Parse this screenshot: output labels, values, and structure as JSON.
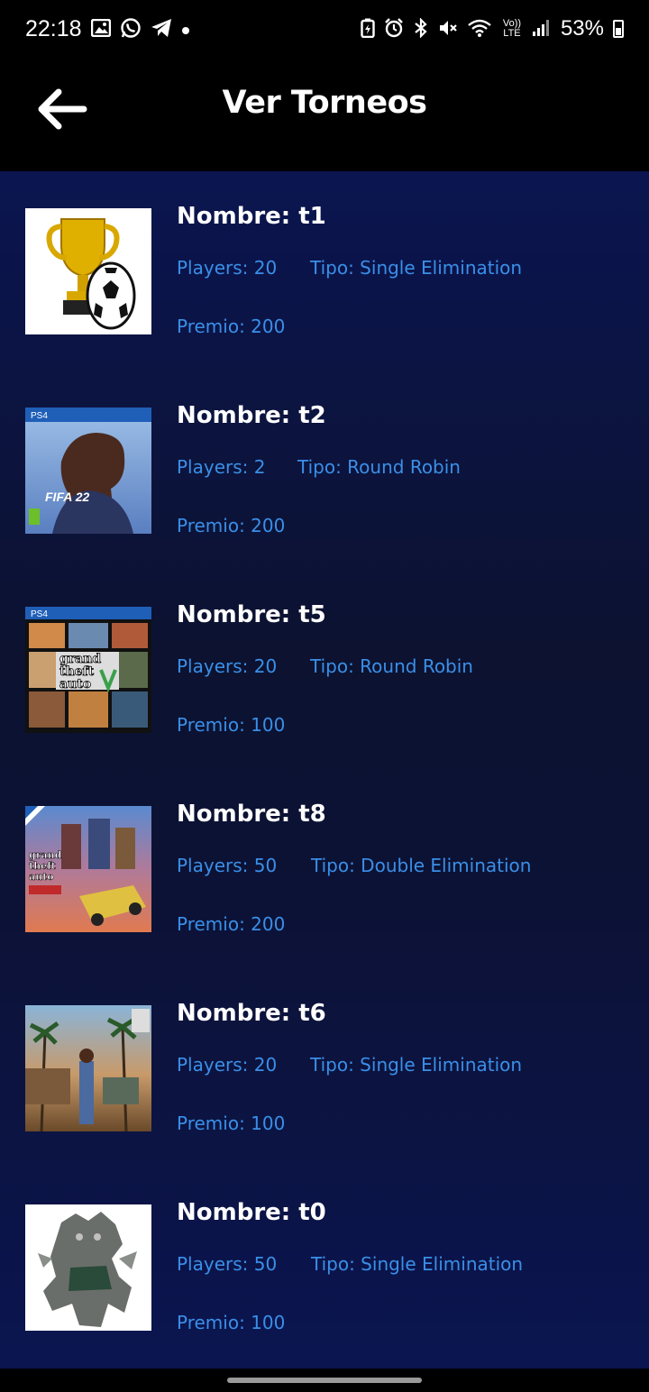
{
  "status_bar": {
    "time": "22:18",
    "left_icons": [
      "image-icon",
      "whatsapp-icon",
      "telegram-icon",
      "dot-icon"
    ],
    "right_icons": [
      "battery-saver-icon",
      "alarm-icon",
      "bluetooth-icon",
      "mute-icon",
      "wifi-icon",
      "volte-icon",
      "signal-icon"
    ],
    "volte_label": "Vo)) LTE",
    "battery_percent": "53%"
  },
  "header": {
    "title": "Ver Torneos",
    "back_icon": "arrow-left-icon"
  },
  "colors": {
    "accent": "#3a8fe8",
    "list_background": "#0c1235",
    "header_background": "#000000"
  },
  "tournaments": [
    {
      "name": "Nombre: t1",
      "players": "Players: 20",
      "tipo": "Tipo: Single Elimination",
      "premio": "Premio: 200",
      "thumb": "trophy-soccer-ball"
    },
    {
      "name": "Nombre: t2",
      "players": "Players: 2",
      "tipo": "Tipo: Round Robin",
      "premio": "Premio: 200",
      "thumb": "fifa-22-cover"
    },
    {
      "name": "Nombre: t5",
      "players": "Players: 20",
      "tipo": "Tipo: Round Robin",
      "premio": "Premio: 100",
      "thumb": "gta-v-cover"
    },
    {
      "name": "Nombre: t8",
      "players": "Players: 50",
      "tipo": "Tipo: Double Elimination",
      "premio": "Premio: 200",
      "thumb": "gta-chinatown-cover"
    },
    {
      "name": "Nombre: t6",
      "players": "Players: 20",
      "tipo": "Tipo: Single Elimination",
      "premio": "Premio: 100",
      "thumb": "gta-san-andreas-scene"
    },
    {
      "name": "Nombre: t0",
      "players": "Players: 50",
      "tipo": "Tipo: Single Elimination",
      "premio": "Premio: 100",
      "thumb": "monster-figure"
    }
  ],
  "thumb_text": {
    "fifa": "FIFA 22",
    "ps4": "PS4",
    "gta_line1": "grand",
    "gta_line2": "theft",
    "gta_line3": "auto"
  }
}
